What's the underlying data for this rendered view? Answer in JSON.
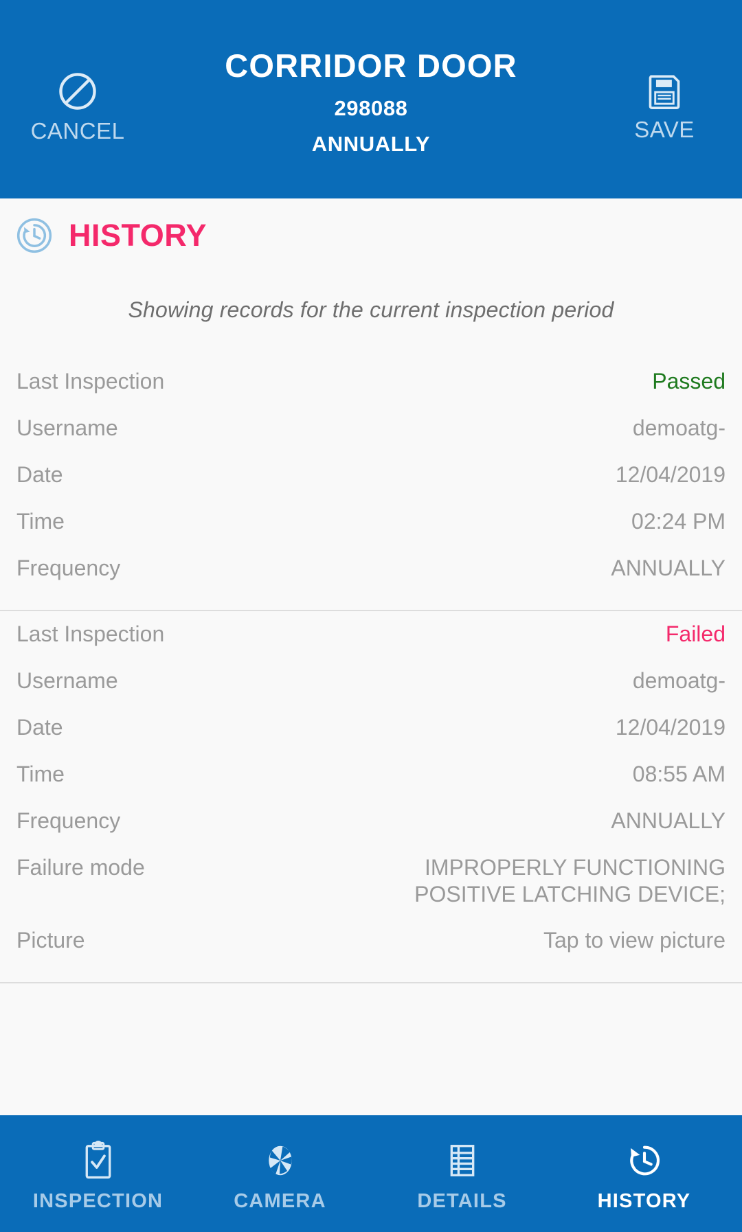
{
  "header": {
    "cancel": {
      "label": "CANCEL",
      "icon": "cancel-circle-slash-icon"
    },
    "save": {
      "label": "SAVE",
      "icon": "floppy-disk-icon"
    },
    "title": "CORRIDOR DOOR",
    "asset_id": "298088",
    "frequency": "ANNUALLY"
  },
  "section": {
    "icon": "history-clock-icon",
    "title": "HISTORY",
    "subtitle": "Showing records for the current inspection period"
  },
  "records": [
    {
      "rows": [
        {
          "label": "Last Inspection",
          "value": "Passed",
          "state": "passed"
        },
        {
          "label": "Username",
          "value": "demoatg-",
          "state": ""
        },
        {
          "label": "Date",
          "value": "12/04/2019",
          "state": ""
        },
        {
          "label": "Time",
          "value": "02:24 PM",
          "state": ""
        },
        {
          "label": "Frequency",
          "value": "ANNUALLY",
          "state": ""
        }
      ]
    },
    {
      "rows": [
        {
          "label": "Last Inspection",
          "value": "Failed",
          "state": "failed"
        },
        {
          "label": "Username",
          "value": "demoatg-",
          "state": ""
        },
        {
          "label": "Date",
          "value": "12/04/2019",
          "state": ""
        },
        {
          "label": "Time",
          "value": "08:55 AM",
          "state": ""
        },
        {
          "label": "Frequency",
          "value": "ANNUALLY",
          "state": ""
        },
        {
          "label": "Failure mode",
          "value": "IMPROPERLY FUNCTIONING\nPOSITIVE LATCHING DEVICE;",
          "state": "multiline"
        },
        {
          "label": "Picture",
          "value": "Tap to view picture",
          "state": ""
        }
      ]
    }
  ],
  "footer": {
    "tabs": [
      {
        "label": "INSPECTION",
        "icon": "clipboard-check-icon",
        "active": false
      },
      {
        "label": "CAMERA",
        "icon": "camera-aperture-icon",
        "active": false
      },
      {
        "label": "DETAILS",
        "icon": "table-list-icon",
        "active": false
      },
      {
        "label": "HISTORY",
        "icon": "history-clock-icon",
        "active": true
      }
    ]
  },
  "colors": {
    "brand_blue": "#0a6cb8",
    "accent_pink": "#f4296b",
    "passed_green": "#1e7a1e",
    "muted_gray": "#9a9a9a",
    "page_bg": "#f9f9f9",
    "icon_light_blue": "#a7cbe8"
  }
}
